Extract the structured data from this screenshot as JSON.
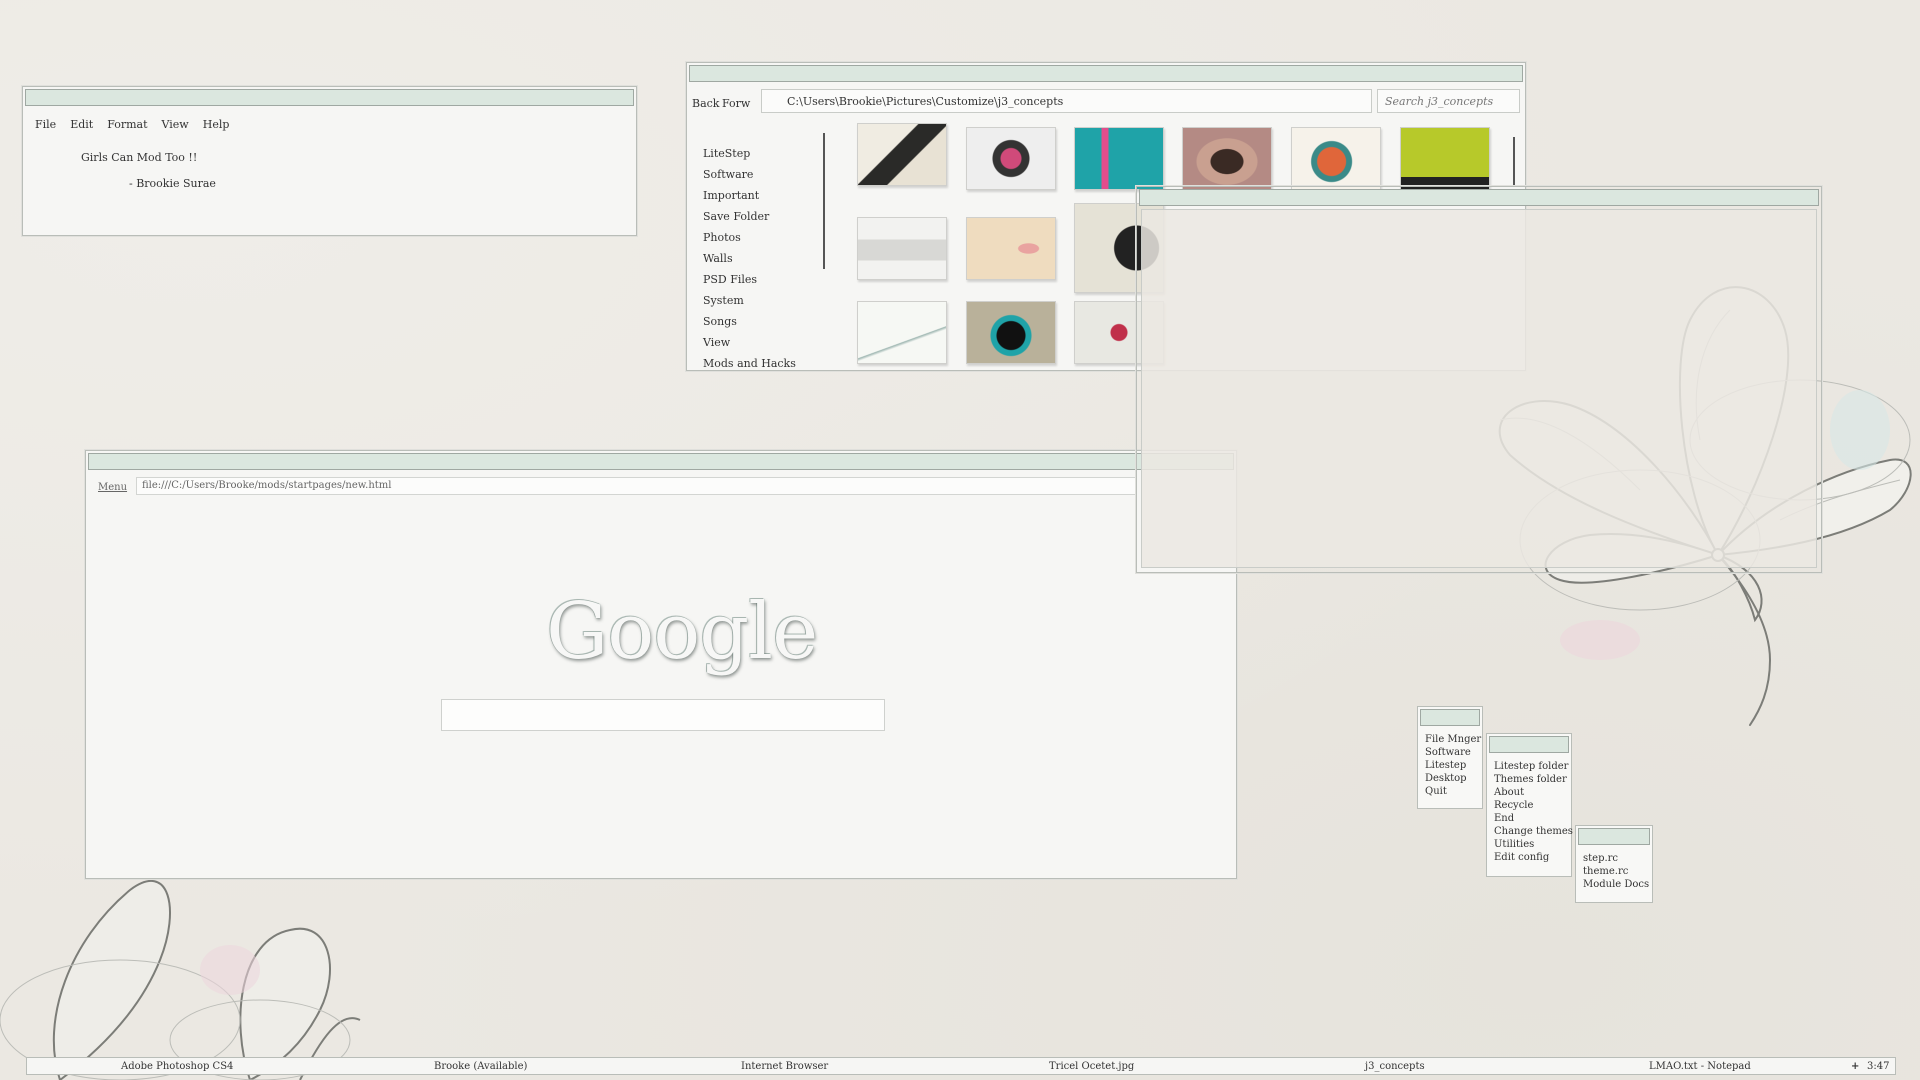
{
  "notepad": {
    "menu": [
      "File",
      "Edit",
      "Format",
      "View",
      "Help"
    ],
    "line1": "Girls Can Mod Too !!",
    "line2": "- Brookie Surae"
  },
  "explorer": {
    "back": "Back",
    "forward": "Forw",
    "address": "C:\\Users\\Brookie\\Pictures\\Customize\\j3_concepts",
    "search_placeholder": "Search j3_concepts",
    "sidebar": [
      "LiteStep",
      "Software",
      "Important",
      "Save Folder",
      "Photos",
      "Walls",
      "PSD Files",
      "System",
      "Songs",
      "View",
      "Mods and Hacks"
    ]
  },
  "browser": {
    "menu": "Menu",
    "url": "file:///C:/Users/Brooke/mods/startpages/new.html",
    "logo": "Google"
  },
  "menus": {
    "main": [
      "File Mnger",
      "Software",
      "Litestep",
      "Desktop",
      "Quit"
    ],
    "litestep": [
      "Litestep folder",
      "Themes folder",
      "About",
      "Recycle",
      "End",
      "Change themes",
      "Utilities",
      "Edit config"
    ],
    "config": [
      "step.rc",
      "theme.rc",
      "Module Docs"
    ]
  },
  "taskbar": {
    "items": [
      "Adobe Photoshop CS4",
      "Brooke (Available)",
      "Internet Browser",
      "Tricel Ocetet.jpg",
      "j3_concepts",
      "LMAO.txt - Notepad"
    ],
    "tray_icon": "+",
    "clock": "3:47"
  },
  "colors": {
    "titlebar": "#dbe7df",
    "background": "#ebe8e2"
  }
}
